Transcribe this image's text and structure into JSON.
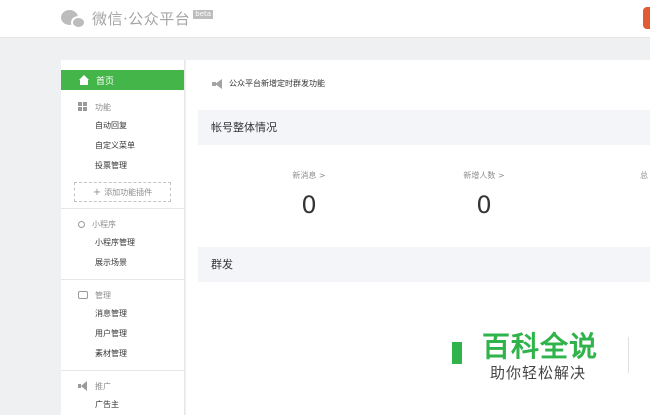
{
  "header": {
    "logo_text": "微信·公众平台",
    "beta_label": "beta"
  },
  "sidebar": {
    "home_label": "首页",
    "sections": [
      {
        "title": "功能",
        "items": [
          "自动回复",
          "自定义菜单",
          "投票管理"
        ]
      },
      {
        "title": "小程序",
        "items": [
          "小程序管理",
          "展示场景"
        ]
      },
      {
        "title": "管理",
        "items": [
          "消息管理",
          "用户管理",
          "素材管理"
        ]
      },
      {
        "title": "推广",
        "items": [
          "广告主"
        ]
      }
    ],
    "add_plugin_label": "添加功能插件"
  },
  "main": {
    "notice": "公众平台新增定时群发功能",
    "account_title": "帐号整体情况",
    "stats": [
      {
        "label": "新消息 >",
        "value": "0"
      },
      {
        "label": "新增人数 >",
        "value": "0"
      },
      {
        "label": "总"
      }
    ],
    "mass_title": "群发"
  },
  "watermark": {
    "title": "百科全说",
    "subtitle": "助你轻松解决"
  },
  "colors": {
    "accent": "#44b549",
    "panel_bg": "#f4f5f9",
    "page_bg": "#eef0f2"
  }
}
